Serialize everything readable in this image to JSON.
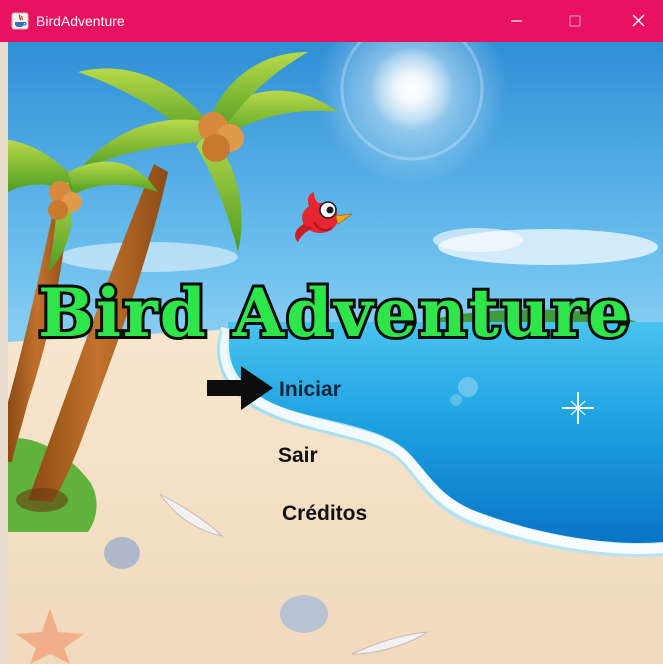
{
  "window": {
    "title": "BirdAdventure",
    "titlebar_color": "#e8105f",
    "controls": [
      "minimize-icon",
      "maximize-icon",
      "close-icon"
    ]
  },
  "game": {
    "title": "Bird Adventure",
    "title_fill": "#2ee64a",
    "title_outline": "#0b0b0b",
    "menu": {
      "start": "Iniciar",
      "exit": "Sair",
      "credits": "Créditos"
    },
    "selected_item": "start",
    "pointer_icon": "arrow-right-icon",
    "mascot_icon": "red-bird-icon"
  }
}
